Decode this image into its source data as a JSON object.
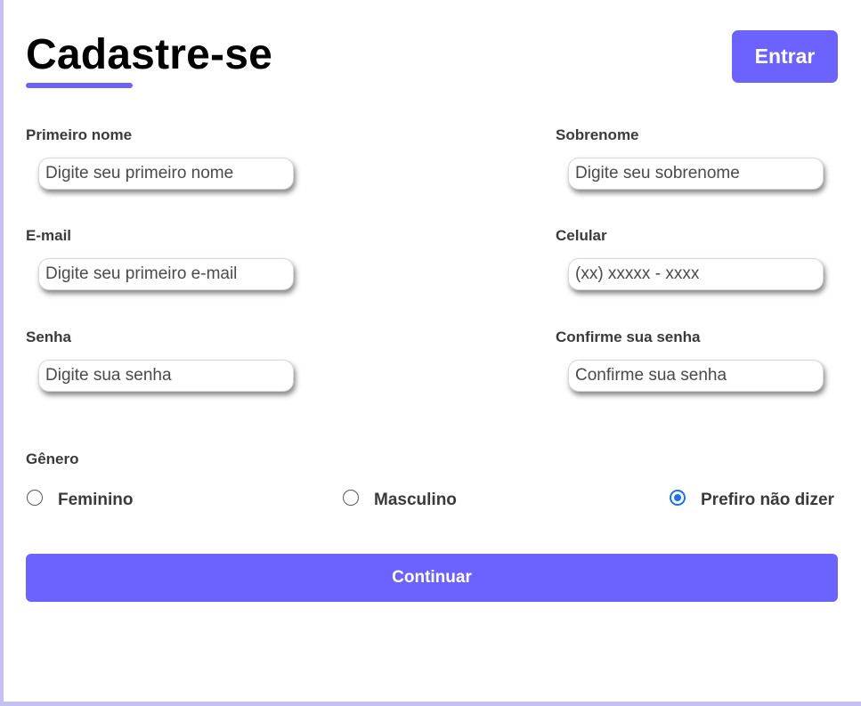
{
  "header": {
    "title": "Cadastre-se",
    "login_label": "Entrar"
  },
  "form": {
    "first_name": {
      "label": "Primeiro nome",
      "placeholder": "Digite seu primeiro nome",
      "value": ""
    },
    "last_name": {
      "label": "Sobrenome",
      "placeholder": "Digite seu sobrenome",
      "value": ""
    },
    "email": {
      "label": "E-mail",
      "placeholder": "Digite seu primeiro e-mail",
      "value": ""
    },
    "phone": {
      "label": "Celular",
      "placeholder": "(xx) xxxxx - xxxx",
      "value": ""
    },
    "password": {
      "label": "Senha",
      "placeholder": "Digite sua senha",
      "value": ""
    },
    "confirm_password": {
      "label": "Confirme sua senha",
      "placeholder": "Confirme sua senha",
      "value": ""
    }
  },
  "gender": {
    "label": "Gênero",
    "options": [
      {
        "label": "Feminino",
        "checked": false
      },
      {
        "label": "Masculino",
        "checked": false
      },
      {
        "label": "Prefiro não dizer",
        "checked": true
      }
    ]
  },
  "actions": {
    "continue_label": "Continuar"
  },
  "colors": {
    "accent": "#6c63ff",
    "radio_selected": "#1a73e8",
    "frame": "#c3c0f2"
  }
}
